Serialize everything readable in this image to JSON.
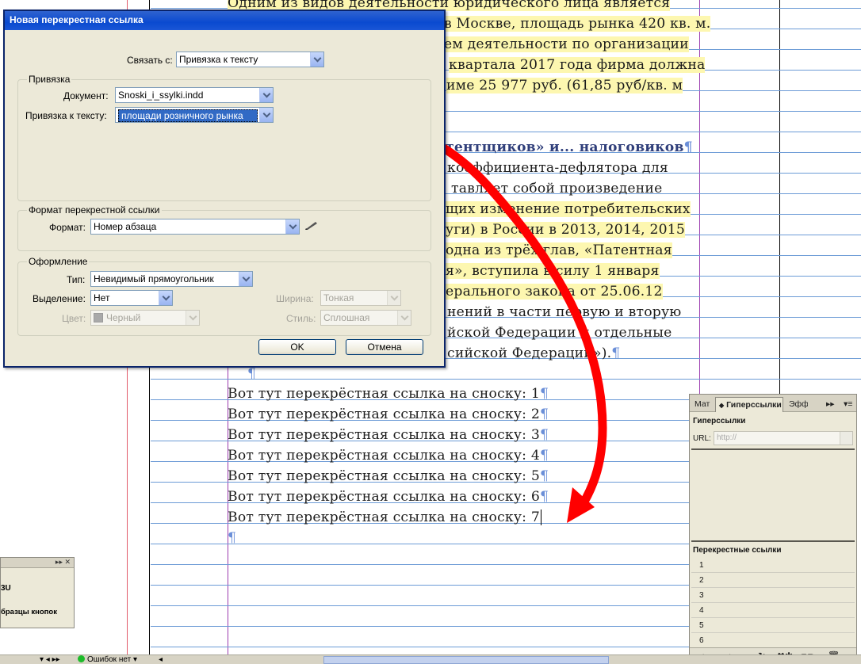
{
  "document": {
    "paragraph_mark": "¶",
    "body_lines": [
      "Одним из видов деятельности юридического лица является",
      "в Москве, площадь рынка 420 кв. м.",
      "ем деятельности по организации",
      "квартала 2017 года фирма должна",
      "име 25 977 руб. (61,85 руб/кв. м",
      "тентщиков» и... налоговиков",
      "коэффициента-дефлятора для",
      "тавляет собой произведение",
      "щих изменение потребительских",
      "уги) в России в 2013, 2014, 2015",
      "одна из трёх глав, «Патентная",
      "я», вступила в силу 1 января",
      "ерального закона от 25.06.12",
      "нений в части первую и вторую",
      "йской Федерации и отдельные",
      "сийской Федерации»)."
    ],
    "xref_lines": [
      "Вот тут перекрёстная ссылка на сноску: 1",
      "Вот тут перекрёстная ссылка на сноску: 2",
      "Вот тут перекрёстная ссылка на сноску: 3",
      "Вот тут перекрёстная ссылка на сноску: 4",
      "Вот тут перекрёстная ссылка на сноску: 5",
      "Вот тут перекрёстная ссылка на сноску: 6",
      "Вот тут перекрёстная ссылка на сноску: 7"
    ]
  },
  "dialog": {
    "title": "Новая перекрестная ссылка",
    "link_to_label": "Связать с:",
    "link_to_value": "Привязка к тексту",
    "anchor_group_title": "Привязка",
    "document_label": "Документ:",
    "document_value": "Snoski_i_ssylki.indd",
    "text_anchor_label": "Привязка к тексту:",
    "text_anchor_value": "площади розничного рынка",
    "format_group_title": "Формат перекрестной ссылки",
    "format_label": "Формат:",
    "format_value": "Номер абзаца",
    "appearance_group_title": "Оформление",
    "type_label": "Тип:",
    "type_value": "Невидимый прямоугольник",
    "highlight_label": "Выделение:",
    "highlight_value": "Нет",
    "color_label": "Цвет:",
    "color_value": "Черный",
    "width_label": "Ширина:",
    "width_value": "Тонкая",
    "style_label": "Стиль:",
    "style_value": "Сплошная",
    "ok_label": "OK",
    "cancel_label": "Отмена"
  },
  "hyperlinks_panel": {
    "tab_1": "Мат",
    "tab_2": "Гиперссылки",
    "tab_3": "Эфф",
    "section_hyperlinks": "Гиперссылки",
    "url_label": "URL:",
    "url_placeholder": "http://",
    "section_xrefs": "Перекрестные ссылки",
    "xref_items": [
      "1",
      "2",
      "3",
      "4",
      "5",
      "6"
    ]
  },
  "small_panel": {
    "line_1": "3U",
    "line_2": "бразцы кнопок"
  },
  "statusbar": {
    "errors_label": "Ошибок нет"
  },
  "colors": {
    "dialog_title_blue": "#0a4ad0",
    "arrow_red": "#ff0000",
    "highlight_yellow": "#fdf7b0",
    "baseline_blue": "#6c9bd6"
  }
}
